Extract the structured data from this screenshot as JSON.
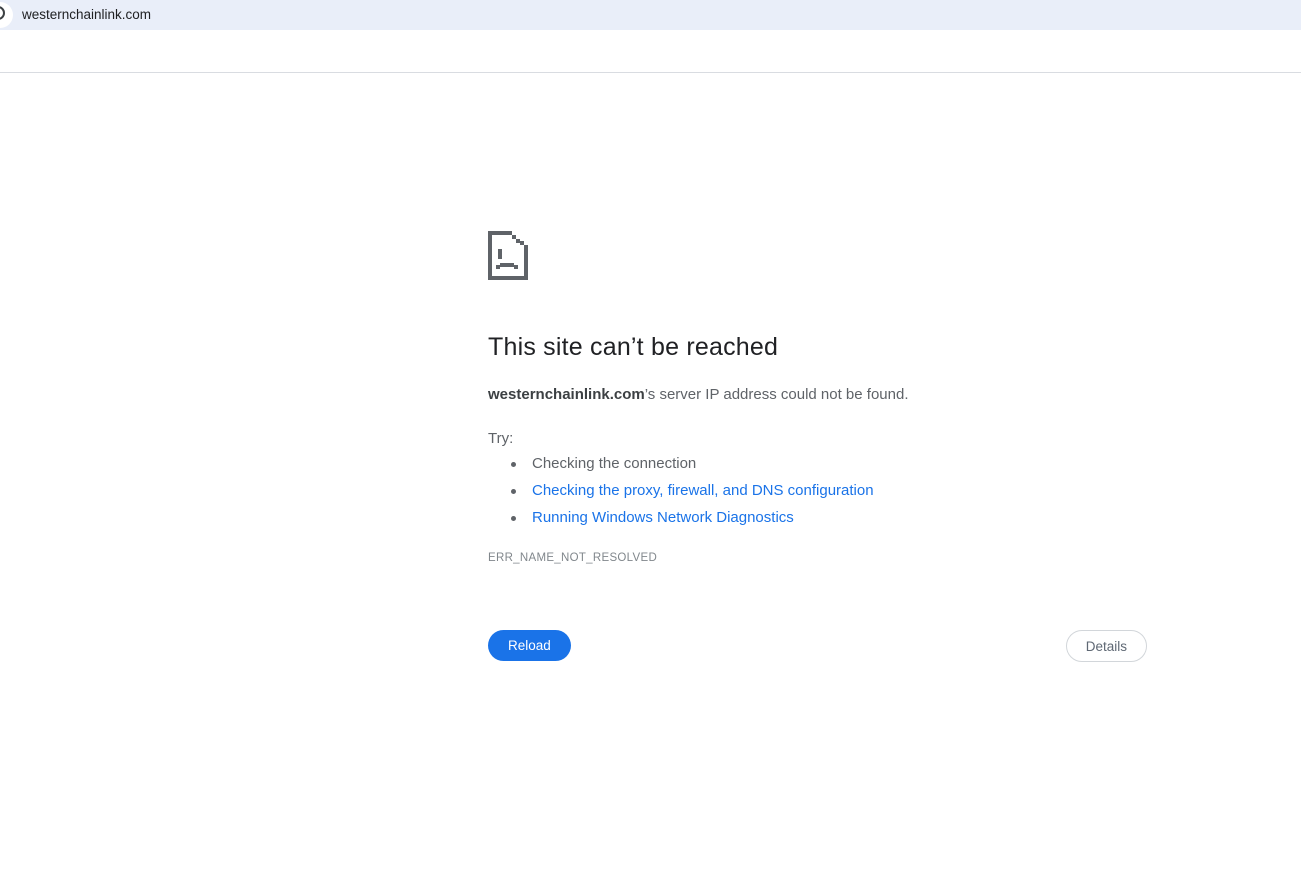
{
  "browser": {
    "tab_title": "westernchainlink.com",
    "tabbar_bg": "#e9eef9",
    "divider_color": "#d9dce1"
  },
  "error_page": {
    "heading": "This site can’t be reached",
    "domain": "westernchainlink.com",
    "message_suffix": "’s server IP address could not be found.",
    "try_label": "Try:",
    "suggestions": [
      {
        "label": "Checking the connection",
        "is_link": false
      },
      {
        "label": "Checking the proxy, firewall, and DNS configuration",
        "is_link": true
      },
      {
        "label": "Running Windows Network Diagnostics",
        "is_link": true
      }
    ],
    "error_code": "ERR_NAME_NOT_RESOLVED",
    "buttons": {
      "reload_label": "Reload",
      "details_label": "Details"
    },
    "colors": {
      "accent_blue": "#1a73e8",
      "heading_dark": "#202124",
      "text_grey": "#5f6368",
      "error_code_grey": "#81878c",
      "icon_grey": "#5f6368"
    }
  }
}
